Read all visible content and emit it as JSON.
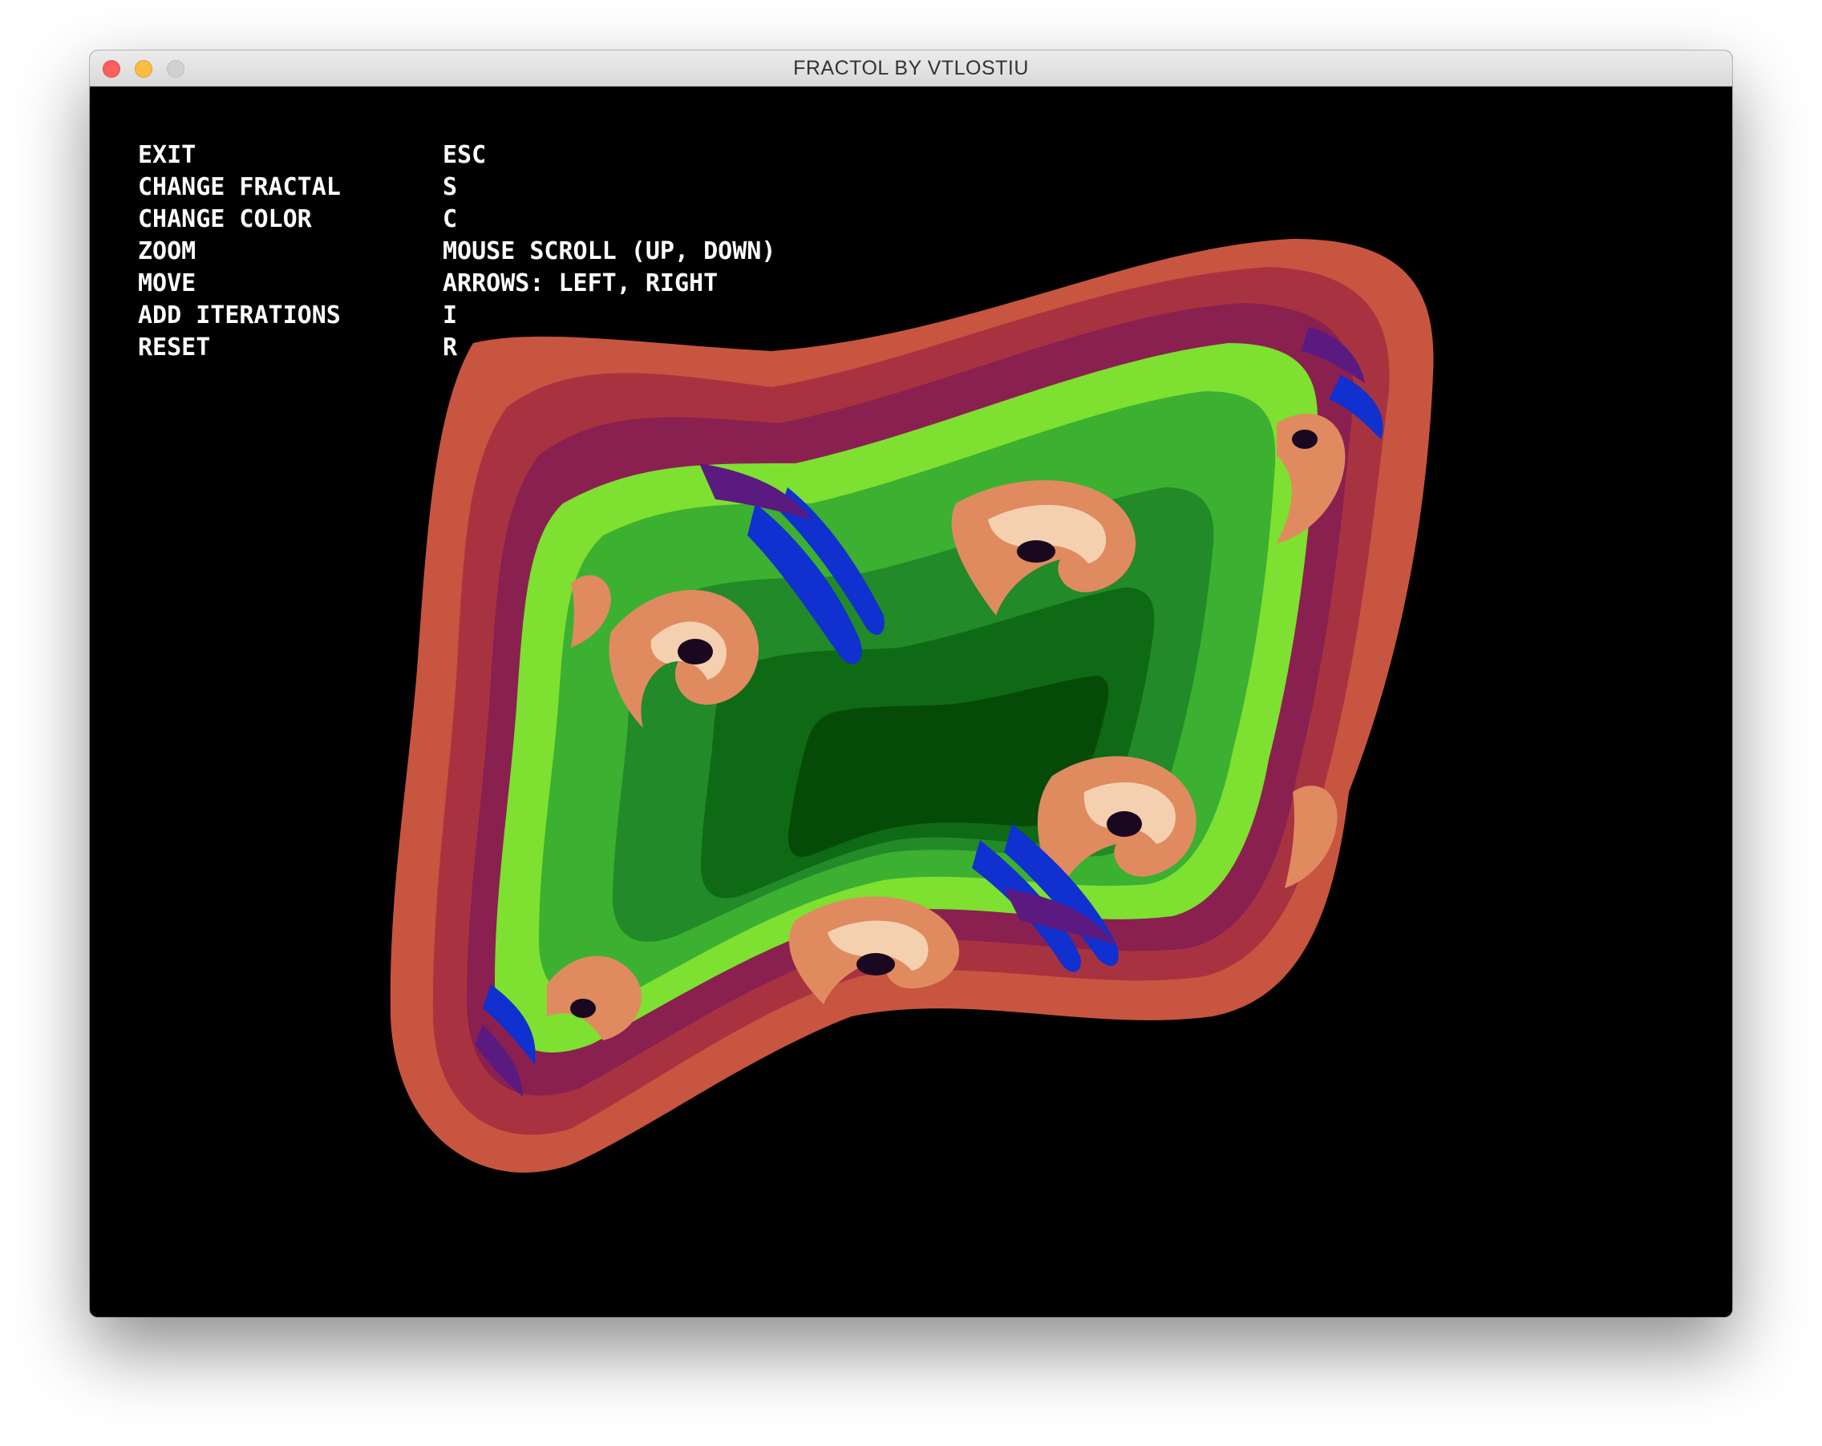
{
  "window": {
    "title": "FRACTOL BY VTLOSTIU"
  },
  "help": {
    "rows": [
      {
        "action": "EXIT",
        "key": "ESC"
      },
      {
        "action": "CHANGE FRACTAL",
        "key": "S"
      },
      {
        "action": "CHANGE COLOR",
        "key": "C"
      },
      {
        "action": "ZOOM",
        "key": "MOUSE SCROLL (UP, DOWN)"
      },
      {
        "action": "MOVE",
        "key": "ARROWS: LEFT, RIGHT"
      },
      {
        "action": "ADD ITERATIONS",
        "key": "I"
      },
      {
        "action": "RESET",
        "key": "R"
      }
    ]
  },
  "colors": {
    "background": "#000000",
    "outer_band": "#c85540",
    "band_2": "#a83340",
    "band_3": "#8a2050",
    "purple": "#5a1a80",
    "blue": "#1030d0",
    "light_green": "#7ee030",
    "green": "#3cb030",
    "mid_green": "#228a28",
    "dark_green": "#0e6a14",
    "darkest_green": "#064a08",
    "salmon": "#e08a60",
    "cream": "#f4d0b0"
  }
}
